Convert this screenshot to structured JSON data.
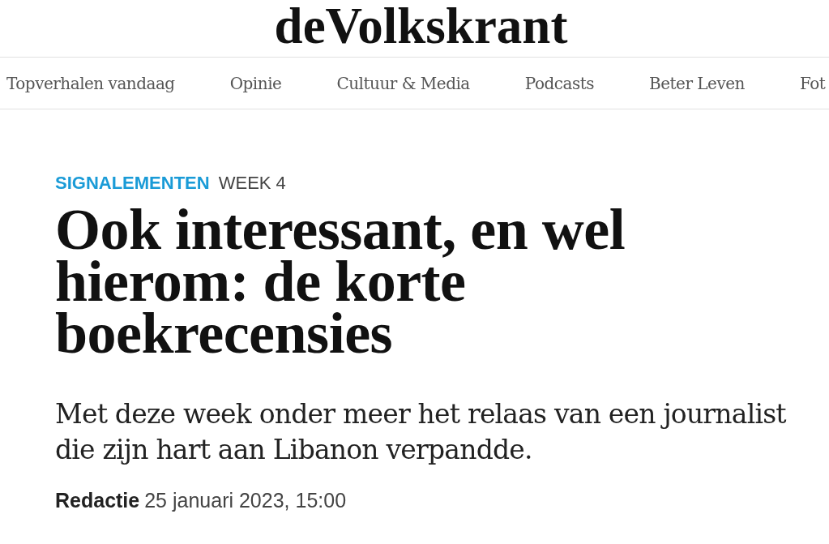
{
  "masthead": {
    "logo": "deVolkskrant"
  },
  "nav": {
    "items": [
      {
        "label": "Topverhalen vandaag"
      },
      {
        "label": "Opinie"
      },
      {
        "label": "Cultuur & Media"
      },
      {
        "label": "Podcasts"
      },
      {
        "label": "Beter Leven"
      },
      {
        "label": "Fot"
      }
    ]
  },
  "article": {
    "section": "SIGNALEMENTEN",
    "series": "WEEK 4",
    "headline": "Ook interessant, en wel hierom: de korte boekrecensies",
    "standfirst": "Met deze week onder meer het relaas van een journalist die zijn hart aan Libanon verpandde.",
    "byline": {
      "author": "Redactie",
      "date": "25 januari 2023, 15:00"
    }
  }
}
